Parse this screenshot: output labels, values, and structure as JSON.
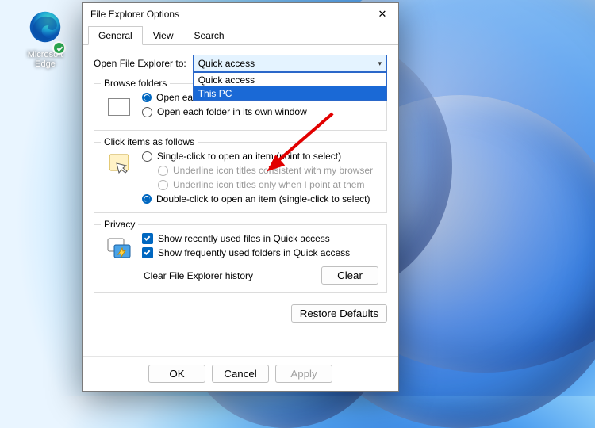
{
  "desktop": {
    "edge_label": "Microsoft Edge"
  },
  "window": {
    "title": "File Explorer Options",
    "tabs": {
      "general": "General",
      "view": "View",
      "search": "Search"
    },
    "open_label": "Open File Explorer to:",
    "combo": {
      "selected": "Quick access",
      "options": [
        "Quick access",
        "This PC"
      ]
    },
    "browse": {
      "title": "Browse folders",
      "same": "Open each folder in the same window",
      "own": "Open each folder in its own window"
    },
    "click": {
      "title": "Click items as follows",
      "single": "Single-click to open an item (point to select)",
      "ul_browser": "Underline icon titles consistent with my browser",
      "ul_point": "Underline icon titles only when I point at them",
      "double": "Double-click to open an item (single-click to select)"
    },
    "privacy": {
      "title": "Privacy",
      "recent_files": "Show recently used files in Quick access",
      "frequent_folders": "Show frequently used folders in Quick access",
      "clear_label": "Clear File Explorer history",
      "clear_btn": "Clear"
    },
    "restore": "Restore Defaults",
    "buttons": {
      "ok": "OK",
      "cancel": "Cancel",
      "apply": "Apply"
    }
  }
}
